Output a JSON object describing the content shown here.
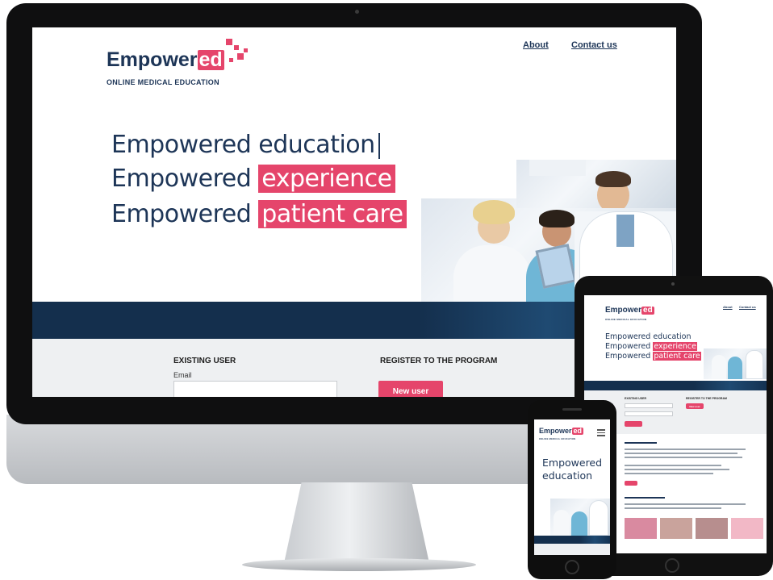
{
  "brand": {
    "name_prefix": "Empower",
    "name_suffix": "ed",
    "tagline": "ONLINE MEDICAL EDUCATION",
    "accent_color": "#e5456b",
    "navy_color": "#1d3557"
  },
  "nav": {
    "about": "About",
    "contact": "Contact us"
  },
  "hero": {
    "line1_prefix": "Empowered",
    "line1_word": "education",
    "line2_prefix": "Empowered",
    "line2_word": "experience",
    "line3_prefix": "Empowered",
    "line3_word": "patient care"
  },
  "login": {
    "existing_title": "EXISTING USER",
    "email_label": "Email",
    "register_title": "REGISTER TO THE PROGRAM",
    "new_user_button": "New user"
  },
  "phone": {
    "hero_line1": "Empowered",
    "hero_line2": "education",
    "menu_icon": "hamburger-menu-icon"
  },
  "icons": {
    "hero_cursor": "text-cursor-icon",
    "logo_pixels": "pixel-burst-icon"
  }
}
